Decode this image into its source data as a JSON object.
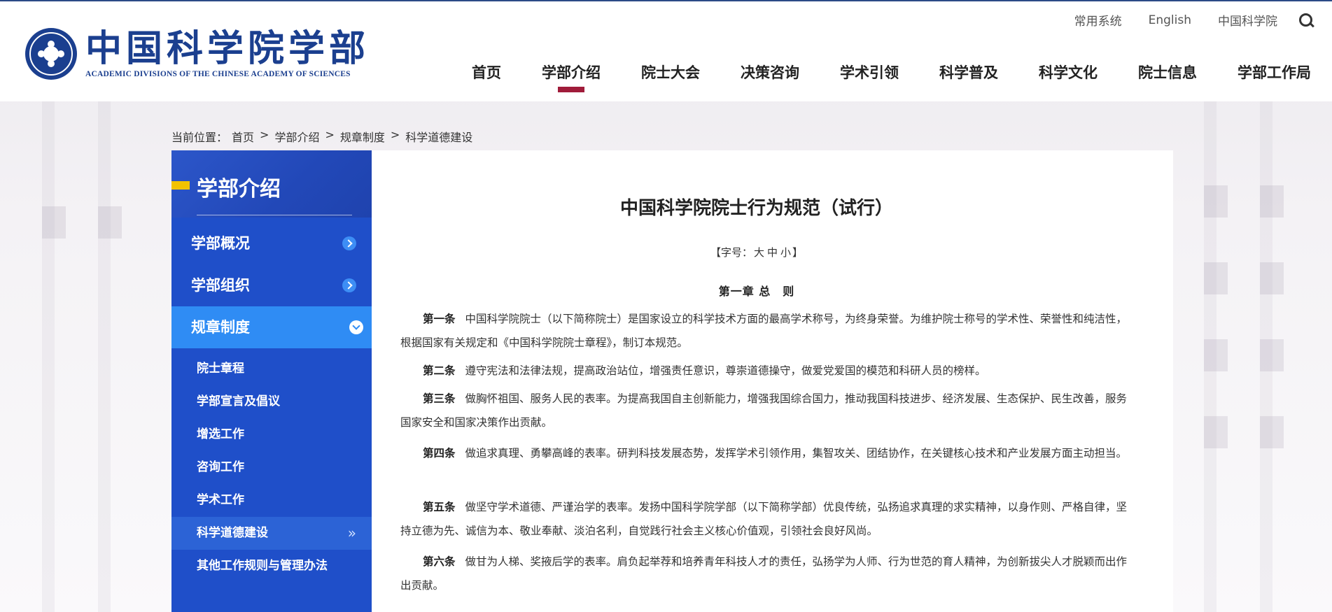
{
  "header": {
    "logo_cn": "中国科学院学部",
    "logo_en": "ACADEMIC DIVISIONS OF THE CHINESE ACADEMY OF SCIENCES",
    "util_links": [
      "常用系统",
      "English",
      "中国科学院"
    ],
    "nav": [
      "首页",
      "学部介绍",
      "院士大会",
      "决策咨询",
      "学术引领",
      "科学普及",
      "科学文化",
      "院士信息",
      "学部工作局"
    ],
    "active_nav": "学部介绍"
  },
  "breadcrumb": {
    "prefix": "当前位置：",
    "items": [
      "首页",
      "学部介绍",
      "规章制度",
      "科学道德建设"
    ],
    "sep": ">"
  },
  "sidebar": {
    "title": "学部介绍",
    "items": [
      "学部概况",
      "学部组织",
      "规章制度"
    ],
    "open_item": "规章制度",
    "sub_items": [
      "院士章程",
      "学部宣言及倡议",
      "增选工作",
      "咨询工作",
      "学术工作",
      "科学道德建设",
      "其他工作规则与管理办法"
    ],
    "current_sub": "科学道德建设"
  },
  "article": {
    "title": "中国科学院院士行为规范（试行）",
    "fontsize": {
      "open": "【字号：",
      "large": "大",
      "medium": "中",
      "small": "小",
      "close": "】"
    },
    "chapter": "第一章 总　则",
    "paragraphs": [
      {
        "label": "第一条",
        "text": "中国科学院院士（以下简称院士）是国家设立的科学技术方面的最高学术称号，为终身荣誉。为维护院士称号的学术性、荣誉性和纯洁性，根据国家有关规定和《中国科学院院士章程》，制订本规范。"
      },
      {
        "label": "第二条",
        "text": "遵守宪法和法律法规，提高政治站位，增强责任意识，尊崇道德操守，做爱党爱国的模范和科研人员的榜样。"
      },
      {
        "label": "第三条",
        "text": "做胸怀祖国、服务人民的表率。为提高我国自主创新能力，增强我国综合国力，推动我国科技进步、经济发展、生态保护、民生改善，服务国家安全和国家决策作出贡献。"
      },
      {
        "label": "第四条",
        "text": "做追求真理、勇攀高峰的表率。研判科技发展态势，发挥学术引领作用，集智攻关、团结协作，在关键核心技术和产业发展方面主动担当。"
      },
      {
        "label": "第五条",
        "text": "做坚守学术道德、严谨治学的表率。发扬中国科学院学部（以下简称学部）优良传统，弘扬追求真理的求实精神，以身作则、严格自律，坚持立德为先、诚信为本、敬业奉献、淡泊名利，自觉践行社会主义核心价值观，引领社会良好风尚。"
      },
      {
        "label": "第六条",
        "text": "做甘为人梯、奖掖后学的表率。肩负起举荐和培养青年科技人才的责任，弘扬学为人师、行为世范的育人精神，为创新拔尖人才脱颖而出作出贡献。"
      }
    ]
  }
}
